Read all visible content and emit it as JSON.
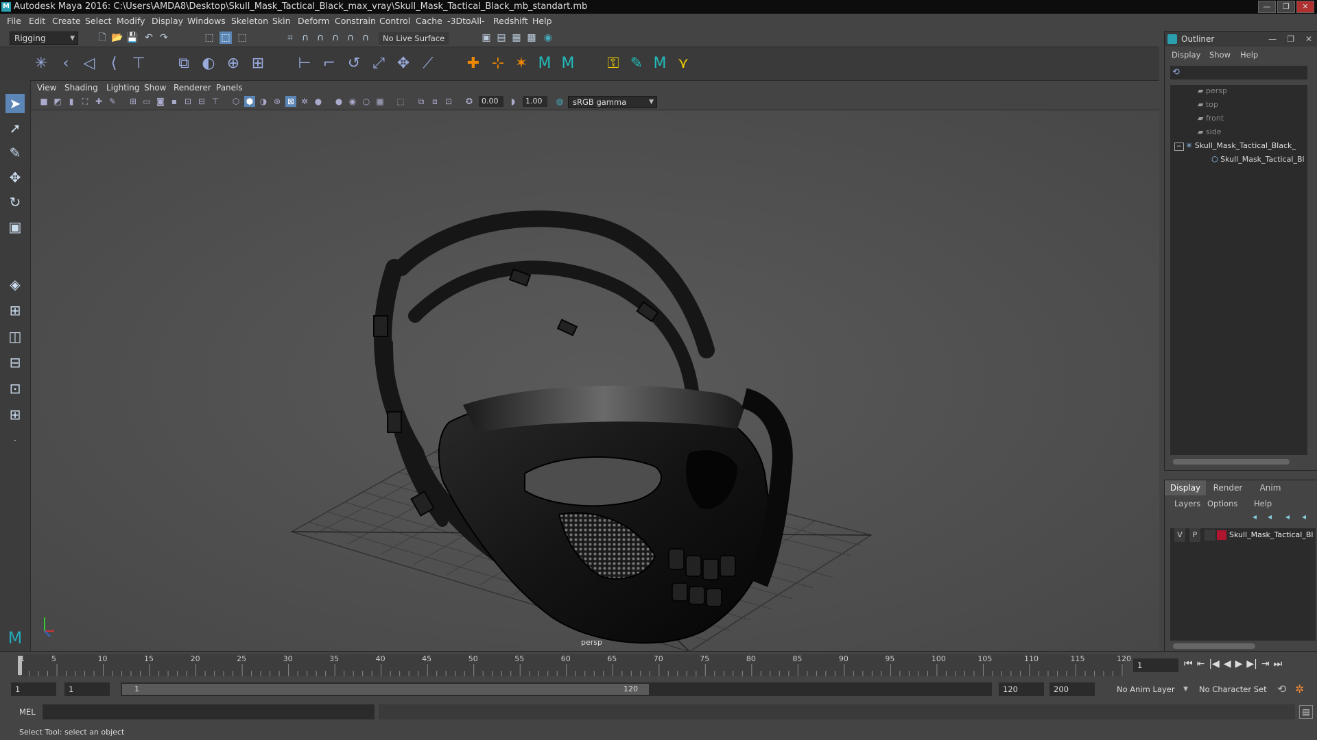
{
  "title": "Autodesk Maya 2016: C:\\Users\\AMDA8\\Desktop\\Skull_Mask_Tactical_Black_max_vray\\Skull_Mask_Tactical_Black_mb_standart.mb",
  "window_buttons": [
    "—",
    "❐",
    "✕"
  ],
  "menubar": [
    "File",
    "Edit",
    "Create",
    "Select",
    "Modify",
    "Display",
    "Windows",
    "Skeleton",
    "Skin",
    "Deform",
    "Constrain",
    "Control",
    "Cache",
    "-3DtoAll-",
    "Redshift",
    "Help"
  ],
  "mode_dropdown": "Rigging",
  "live_surface": "No Live Surface",
  "panel_menu": [
    "View",
    "Shading",
    "Lighting",
    "Show",
    "Renderer",
    "Panels"
  ],
  "panel_fields": {
    "near": "0.00",
    "far": "1.00",
    "color_space": "sRGB gamma"
  },
  "viewport_label": "persp",
  "outliner": {
    "title": "Outliner",
    "menu": [
      "Display",
      "Show",
      "Help"
    ],
    "items": [
      {
        "label": "persp"
      },
      {
        "label": "top"
      },
      {
        "label": "front"
      },
      {
        "label": "side"
      },
      {
        "label": "Skull_Mask_Tactical_Black_"
      },
      {
        "label": "Skull_Mask_Tactical_Bl"
      }
    ]
  },
  "layers": {
    "tabs": [
      "Display",
      "Render",
      "Anim"
    ],
    "menu": [
      "Layers",
      "Options",
      "Help"
    ],
    "row": {
      "v": "V",
      "p": "P",
      "name": "Skull_Mask_Tactical_Bl",
      "color": "#b01530"
    }
  },
  "timeline": {
    "ticks": [
      1,
      5,
      10,
      15,
      20,
      25,
      30,
      35,
      40,
      45,
      50,
      55,
      60,
      65,
      70,
      75,
      80,
      85,
      90,
      95,
      100,
      105,
      110,
      115,
      120
    ],
    "current_frame": "1"
  },
  "range": {
    "start": "1",
    "start_inner": "1",
    "slider_start": "1",
    "slider_end": "120",
    "end_inner": "120",
    "end": "200",
    "anim_layer": "No Anim Layer",
    "char_set": "No Character Set"
  },
  "cmd": {
    "label": "MEL"
  },
  "help_line": "Select Tool: select an object",
  "colors": {
    "accent": "#2a9fb0",
    "viewport_bg": "#505050",
    "selected_tool": "#5b86b5"
  }
}
